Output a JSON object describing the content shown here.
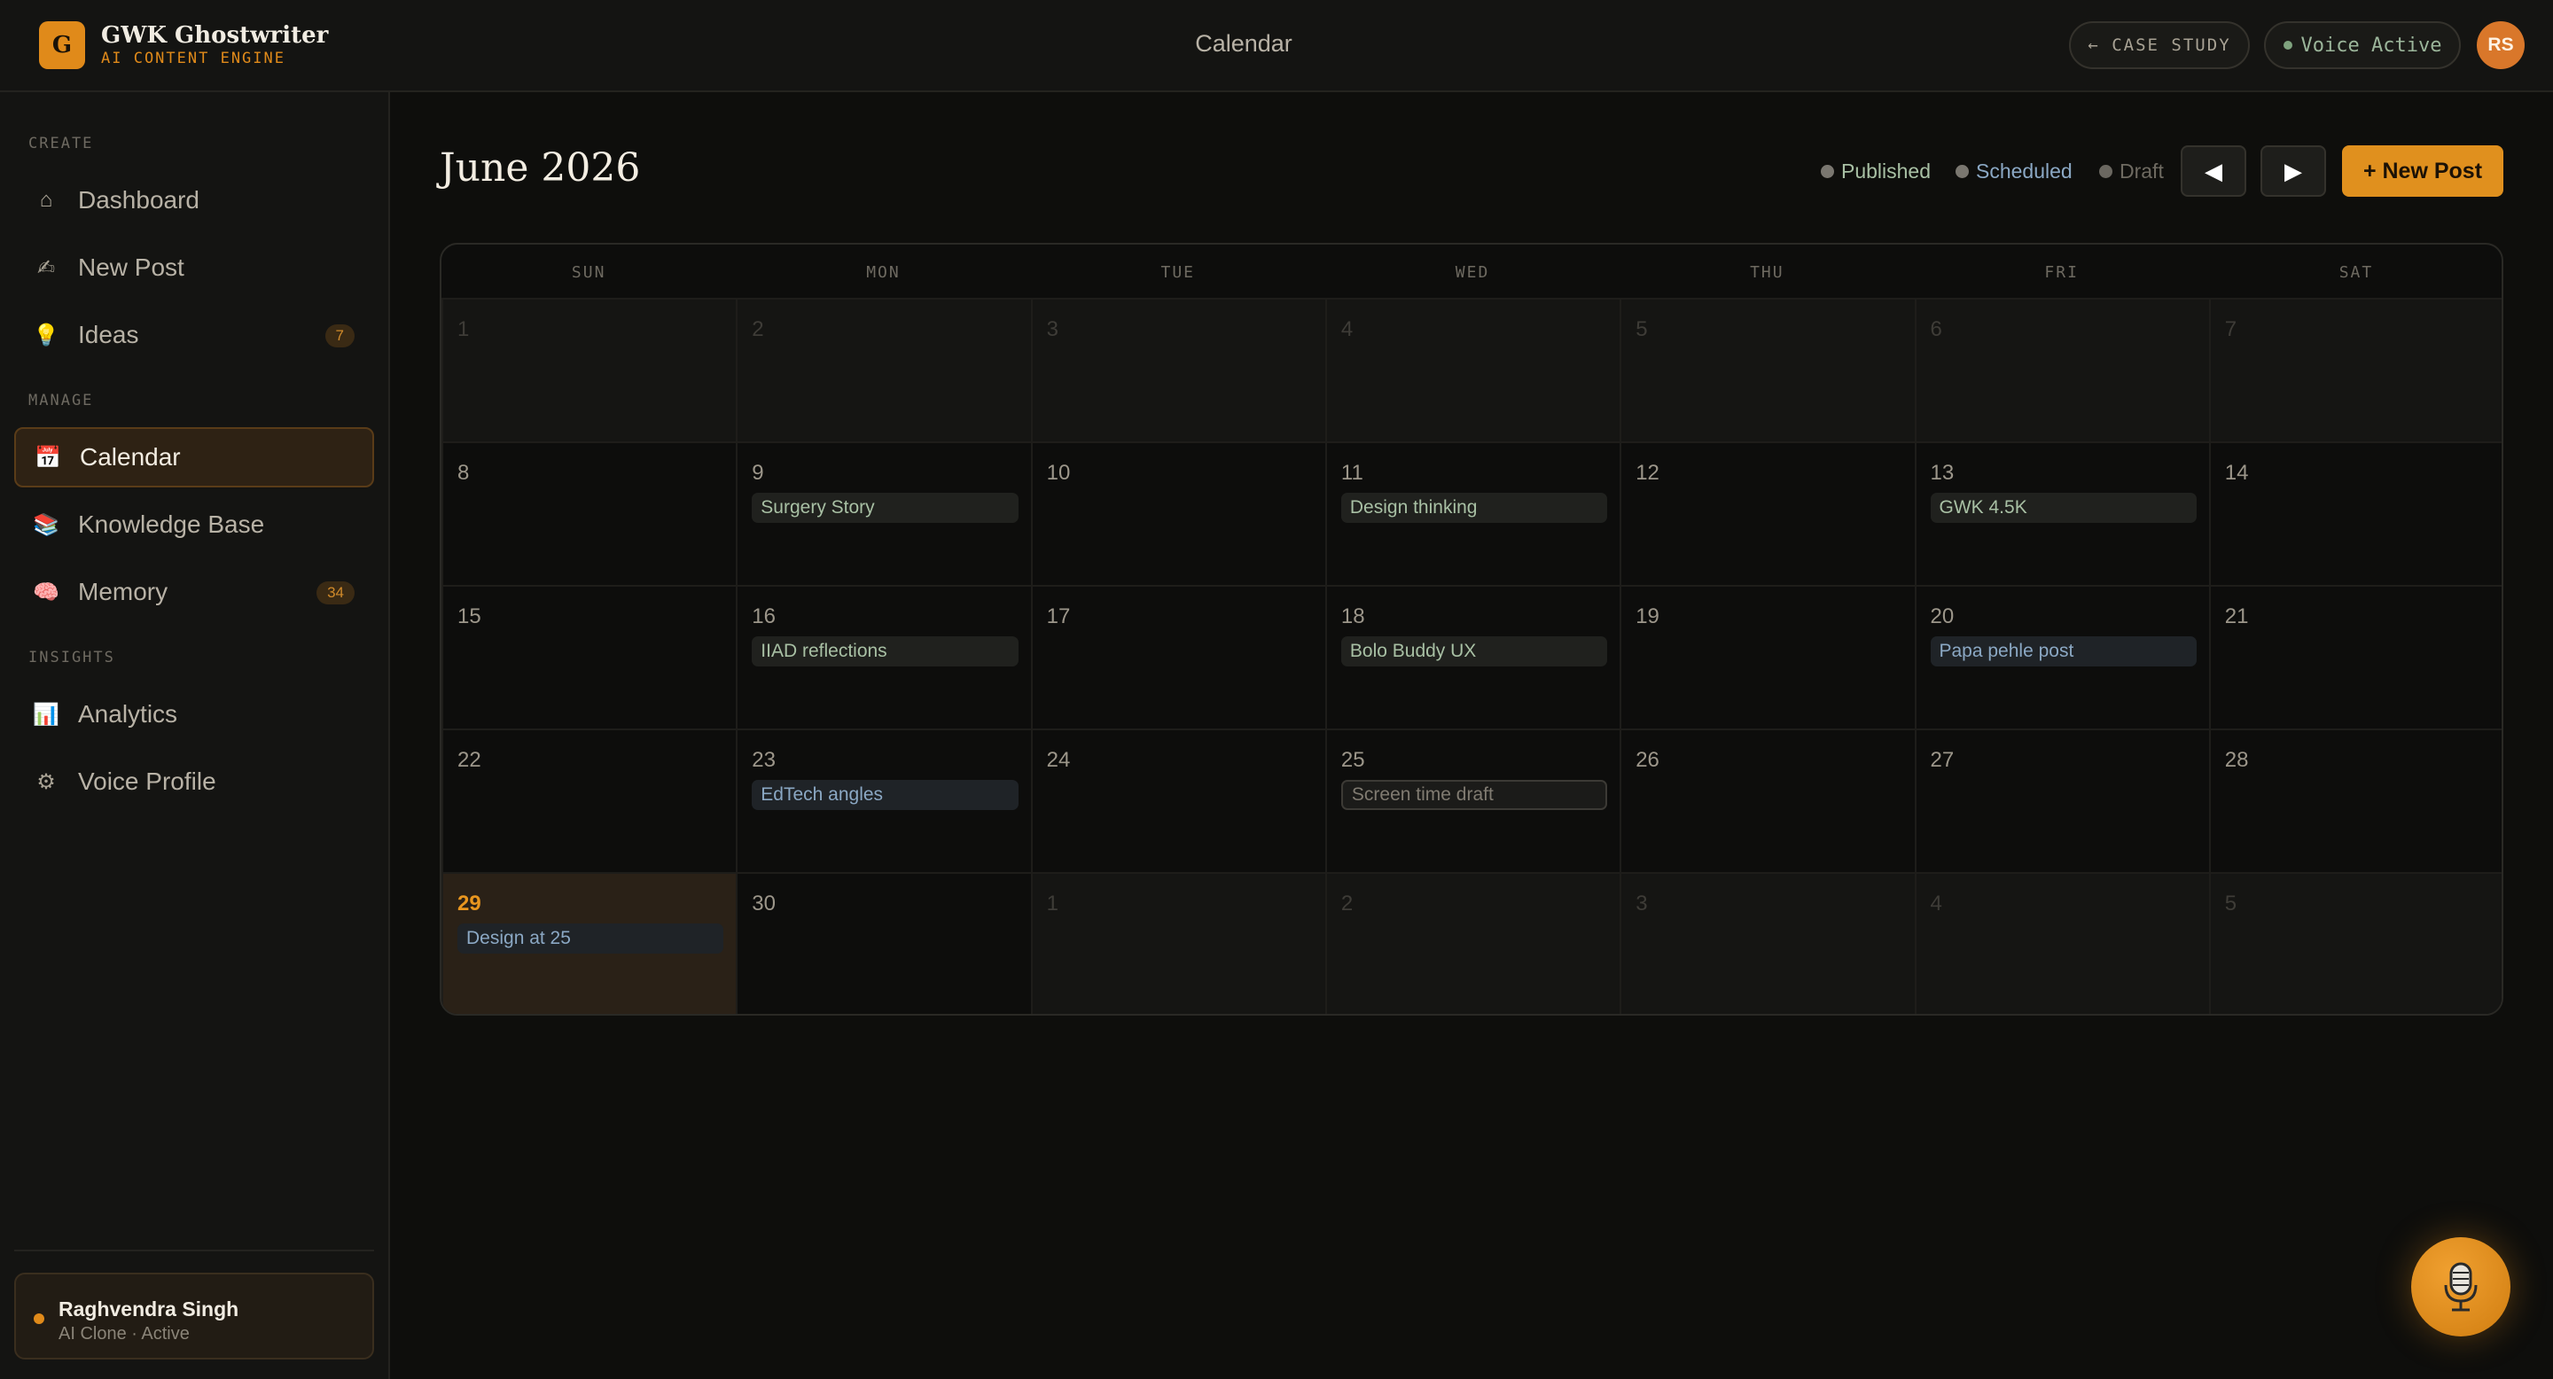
{
  "app": {
    "logo_letter": "G",
    "name": "GWK Ghostwriter",
    "subtitle": "AI CONTENT ENGINE"
  },
  "header": {
    "title": "Calendar",
    "case_study": "← CASE STUDY",
    "voice_status": "Voice Active",
    "avatar_initials": "RS"
  },
  "sidebar": {
    "sections": [
      {
        "label": "CREATE"
      },
      {
        "label": "MANAGE"
      },
      {
        "label": "INSIGHTS"
      }
    ],
    "items": [
      {
        "label": "Dashboard",
        "icon": "home-icon",
        "glyph": "⌂"
      },
      {
        "label": "New Post",
        "icon": "writing-hand-icon",
        "glyph": "✍"
      },
      {
        "label": "Ideas",
        "icon": "lightbulb-icon",
        "glyph": "💡",
        "badge": "7"
      },
      {
        "label": "Calendar",
        "icon": "calendar-icon",
        "glyph": "📅",
        "active": true
      },
      {
        "label": "Knowledge Base",
        "icon": "books-icon",
        "glyph": "📚"
      },
      {
        "label": "Memory",
        "icon": "brain-icon",
        "glyph": "🧠",
        "badge": "34"
      },
      {
        "label": "Analytics",
        "icon": "bar-chart-icon",
        "glyph": "📊"
      },
      {
        "label": "Voice Profile",
        "icon": "gear-icon",
        "glyph": "⚙"
      }
    ],
    "user": {
      "name": "Raghvendra Singh",
      "status": "AI Clone · Active"
    }
  },
  "calendar": {
    "month_label": "June 2026",
    "legend": [
      {
        "label": "Published",
        "color": "#7a7770",
        "text_color": "#a8c0a4"
      },
      {
        "label": "Scheduled",
        "color": "#7a7770",
        "text_color": "#8ba8c4"
      },
      {
        "label": "Draft",
        "color": "#6a6760",
        "text_color": "#6e6a61"
      }
    ],
    "prev_glyph": "◀",
    "next_glyph": "▶",
    "new_post_label": "+ New Post",
    "weekdays": [
      "SUN",
      "MON",
      "TUE",
      "WED",
      "THU",
      "FRI",
      "SAT"
    ],
    "weeks": [
      [
        {
          "day": "1",
          "outside": true
        },
        {
          "day": "2",
          "outside": true
        },
        {
          "day": "3",
          "outside": true
        },
        {
          "day": "4",
          "outside": true
        },
        {
          "day": "5",
          "outside": true
        },
        {
          "day": "6",
          "outside": true
        },
        {
          "day": "7",
          "outside": true
        }
      ],
      [
        {
          "day": "8"
        },
        {
          "day": "9",
          "post": {
            "title": "Surgery Story",
            "status": "published"
          }
        },
        {
          "day": "10"
        },
        {
          "day": "11",
          "post": {
            "title": "Design thinking",
            "status": "published"
          }
        },
        {
          "day": "12"
        },
        {
          "day": "13",
          "post": {
            "title": "GWK 4.5K",
            "status": "published"
          }
        },
        {
          "day": "14"
        }
      ],
      [
        {
          "day": "15"
        },
        {
          "day": "16",
          "post": {
            "title": "IIAD reflections",
            "status": "published"
          }
        },
        {
          "day": "17"
        },
        {
          "day": "18",
          "post": {
            "title": "Bolo Buddy UX",
            "status": "published"
          }
        },
        {
          "day": "19"
        },
        {
          "day": "20",
          "post": {
            "title": "Papa pehle post",
            "status": "scheduled"
          }
        },
        {
          "day": "21"
        }
      ],
      [
        {
          "day": "22"
        },
        {
          "day": "23",
          "post": {
            "title": "EdTech angles",
            "status": "scheduled"
          }
        },
        {
          "day": "24"
        },
        {
          "day": "25",
          "post": {
            "title": "Screen time draft",
            "status": "draft"
          }
        },
        {
          "day": "26"
        },
        {
          "day": "27"
        },
        {
          "day": "28"
        }
      ],
      [
        {
          "day": "29",
          "today": true,
          "post": {
            "title": "Design at 25",
            "status": "scheduled"
          }
        },
        {
          "day": "30"
        },
        {
          "day": "1",
          "outside": true
        },
        {
          "day": "2",
          "outside": true
        },
        {
          "day": "3",
          "outside": true
        },
        {
          "day": "4",
          "outside": true
        },
        {
          "day": "5",
          "outside": true
        }
      ]
    ]
  },
  "fab": {
    "icon": "microphone-icon",
    "glyph": "🎙"
  }
}
